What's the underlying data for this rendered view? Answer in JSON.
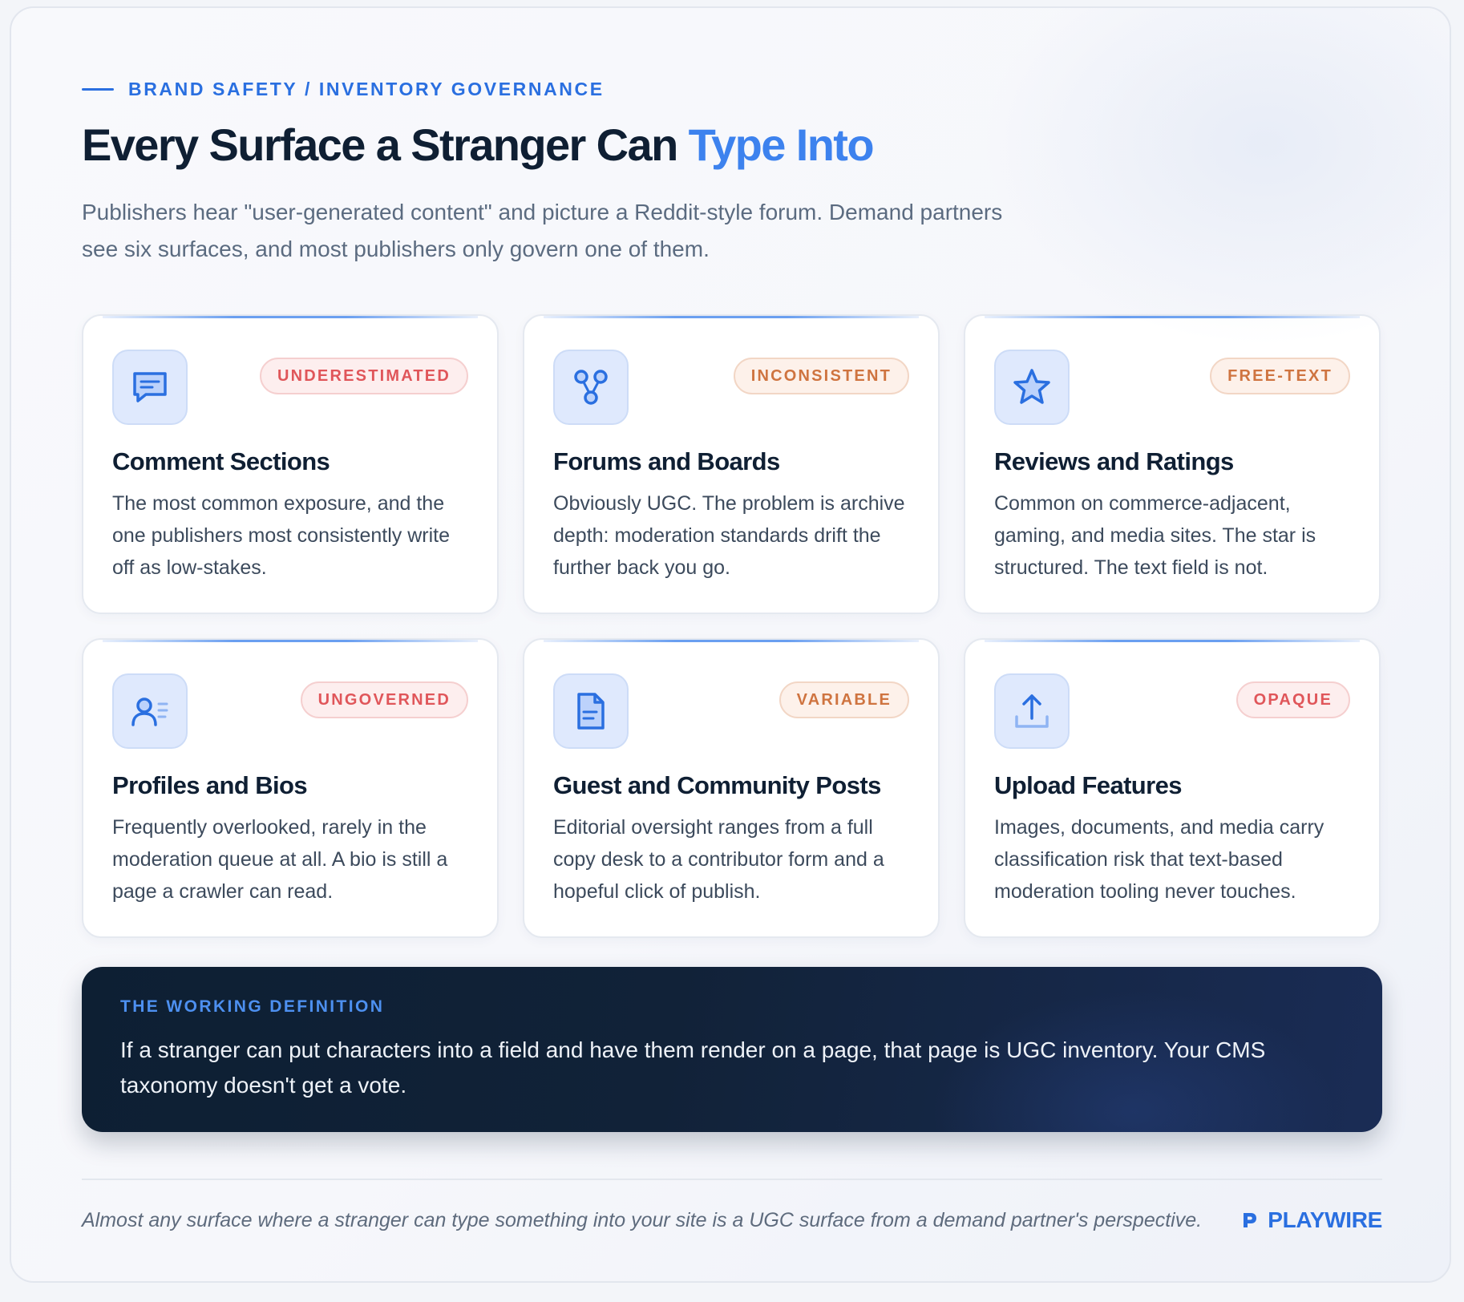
{
  "header": {
    "eyebrow": "BRAND SAFETY / INVENTORY GOVERNANCE",
    "title_main": "Every Surface a Stranger Can ",
    "title_accent": "Type Into",
    "subtitle": "Publishers hear \"user-generated content\" and picture a Reddit-style forum. Demand partners see six surfaces, and most publishers only govern one of them."
  },
  "cards": [
    {
      "icon": "comment-icon",
      "badge": "UNDERESTIMATED",
      "badge_color": "#e0565a",
      "title": "Comment Sections",
      "body": "The most common exposure, and the one publishers most consistently write off as low-stakes."
    },
    {
      "icon": "forum-nodes-icon",
      "badge": "INCONSISTENT",
      "badge_color": "#cf7440",
      "title": "Forums and Boards",
      "body": "Obviously UGC. The problem is archive depth: moderation standards drift the further back you go."
    },
    {
      "icon": "star-icon",
      "badge": "FREE-TEXT",
      "badge_color": "#cf7440",
      "title": "Reviews and Ratings",
      "body": "Common on commerce-adjacent, gaming, and media sites. The star is structured. The text field is not."
    },
    {
      "icon": "profile-icon",
      "badge": "UNGOVERNED",
      "badge_color": "#e0565a",
      "title": "Profiles and Bios",
      "body": "Frequently overlooked, rarely in the moderation queue at all. A bio is still a page a crawler can read."
    },
    {
      "icon": "document-icon",
      "badge": "VARIABLE",
      "badge_color": "#cf7440",
      "title": "Guest and Community Posts",
      "body": "Editorial oversight ranges from a full copy desk to a contributor form and a hopeful click of publish."
    },
    {
      "icon": "upload-icon",
      "badge": "OPAQUE",
      "badge_color": "#e0565a",
      "title": "Upload Features",
      "body": "Images, documents, and media carry classification risk that text-based moderation tooling never touches."
    }
  ],
  "definition": {
    "label": "THE WORKING DEFINITION",
    "text": "If a stranger can put characters into a field and have them render on a page, that page is UGC inventory. Your CMS taxonomy doesn't get a vote."
  },
  "footer": {
    "note": "Almost any surface where a stranger can type something into your site is a UGC surface from a demand partner's perspective.",
    "brand": "PLAYWIRE",
    "brand_icon": "playwire-logo-icon"
  },
  "colors": {
    "accent": "#3d82ee",
    "brand_blue": "#2a6fe0",
    "dark_panel": "#0d1f33",
    "risk_red": "#e0565a",
    "risk_orange": "#cf7440"
  }
}
